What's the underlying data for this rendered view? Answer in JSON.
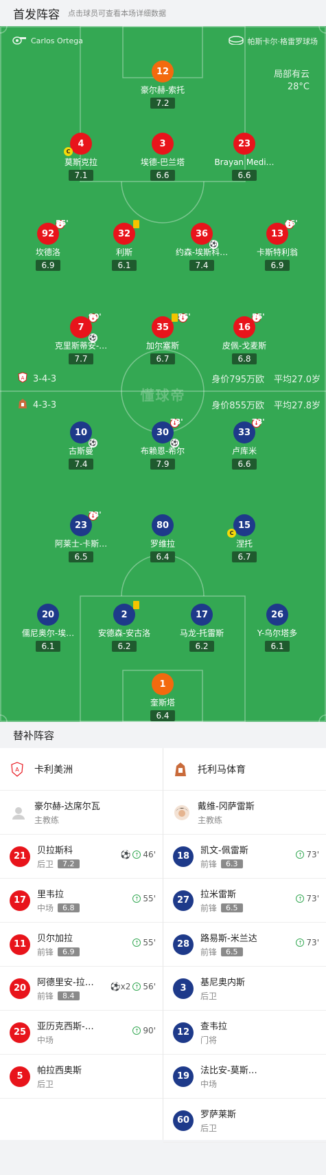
{
  "header": {
    "title": "首发阵容",
    "subtitle": "点击球员可查看本场详细数据"
  },
  "pitch": {
    "referee": "Carlos Ortega",
    "venue": "帕斯卡尔·格雷罗球场",
    "weather": "局部有云",
    "temperature": "28°C",
    "watermark": "懂球帝",
    "home": {
      "formation": "3-4-3",
      "value": "身价795万欧",
      "age": "平均27.0岁"
    },
    "away": {
      "formation": "4-3-3",
      "value": "身价855万欧",
      "age": "平均27.8岁"
    },
    "home_players": [
      {
        "num": "12",
        "name": "豪尔赫-索托",
        "rating": "7.2"
      },
      {
        "num": "4",
        "name": "莫斯克拉",
        "rating": "7.1"
      },
      {
        "num": "3",
        "name": "埃德-巴兰塔",
        "rating": "6.6"
      },
      {
        "num": "23",
        "name": "Brayan Medi…",
        "rating": "6.6"
      },
      {
        "num": "92",
        "name": "坎德洛",
        "rating": "6.9",
        "sub": "55'"
      },
      {
        "num": "32",
        "name": "利斯",
        "rating": "6.1"
      },
      {
        "num": "36",
        "name": "约森-埃斯科…",
        "rating": "7.4"
      },
      {
        "num": "13",
        "name": "卡斯特利翁",
        "rating": "6.9",
        "sub": "46'"
      },
      {
        "num": "7",
        "name": "克里斯蒂安-…",
        "rating": "7.7",
        "sub": "90'"
      },
      {
        "num": "35",
        "name": "加尔塞斯",
        "rating": "6.7",
        "sub": "56'"
      },
      {
        "num": "16",
        "name": "皮佩-戈麦斯",
        "rating": "6.8",
        "sub": "55'"
      }
    ],
    "away_players": [
      {
        "num": "10",
        "name": "古斯曼",
        "rating": "7.4"
      },
      {
        "num": "30",
        "name": "布赖恩-希尔",
        "rating": "7.9",
        "sub": "73'"
      },
      {
        "num": "33",
        "name": "卢库米",
        "rating": "6.6",
        "sub": "73'"
      },
      {
        "num": "23",
        "name": "阿莱士-卡斯…",
        "rating": "6.5",
        "sub": "73'"
      },
      {
        "num": "80",
        "name": "罗维拉",
        "rating": "6.4"
      },
      {
        "num": "15",
        "name": "涅托",
        "rating": "6.7"
      },
      {
        "num": "20",
        "name": "儒尼奥尔-埃…",
        "rating": "6.1"
      },
      {
        "num": "2",
        "name": "安德森-安古洛",
        "rating": "6.2"
      },
      {
        "num": "17",
        "name": "马龙-托雷斯",
        "rating": "6.2"
      },
      {
        "num": "26",
        "name": "Y-乌尔塔多",
        "rating": "6.1"
      },
      {
        "num": "1",
        "name": "奎斯塔",
        "rating": "6.4"
      }
    ]
  },
  "subs": {
    "title": "替补阵容",
    "home_team": "卡利美洲",
    "away_team": "托利马体育",
    "home_coach": {
      "name": "豪尔赫-达席尔瓦",
      "role": "主教练"
    },
    "away_coach": {
      "name": "戴维-冈萨雷斯",
      "role": "主教练"
    },
    "home": [
      {
        "num": "21",
        "name": "贝拉斯科",
        "pos": "后卫",
        "rating": "7.2",
        "evt": "46'",
        "goal": "⚽"
      },
      {
        "num": "17",
        "name": "里韦拉",
        "pos": "中场",
        "rating": "6.8",
        "evt": "55'"
      },
      {
        "num": "11",
        "name": "贝尔加拉",
        "pos": "前锋",
        "rating": "6.9",
        "evt": "55'"
      },
      {
        "num": "20",
        "name": "阿德里安-拉…",
        "pos": "前锋",
        "rating": "8.4",
        "evt": "56'",
        "goal": "⚽x2"
      },
      {
        "num": "25",
        "name": "亚历克西斯-…",
        "pos": "中场",
        "rating": "",
        "evt": "90'"
      },
      {
        "num": "5",
        "name": "帕拉西奥斯",
        "pos": "后卫",
        "rating": "",
        "evt": ""
      }
    ],
    "away": [
      {
        "num": "18",
        "name": "凯文-佩雷斯",
        "pos": "前锋",
        "rating": "6.3",
        "evt": "73'"
      },
      {
        "num": "27",
        "name": "拉米雷斯",
        "pos": "前锋",
        "rating": "6.5",
        "evt": "73'"
      },
      {
        "num": "28",
        "name": "路易斯-米兰达",
        "pos": "前锋",
        "rating": "6.5",
        "evt": "73'"
      },
      {
        "num": "3",
        "name": "基尼奥内斯",
        "pos": "后卫",
        "rating": "",
        "evt": ""
      },
      {
        "num": "12",
        "name": "查韦拉",
        "pos": "门将",
        "rating": "",
        "evt": ""
      },
      {
        "num": "19",
        "name": "法比安-莫斯…",
        "pos": "中场",
        "rating": "",
        "evt": ""
      },
      {
        "num": "60",
        "name": "罗萨莱斯",
        "pos": "后卫",
        "rating": "",
        "evt": ""
      }
    ]
  },
  "colors": {
    "pitch": "#34a853",
    "home": "#e8141b",
    "away": "#1e3a8a",
    "gk": "#f36a0e"
  }
}
